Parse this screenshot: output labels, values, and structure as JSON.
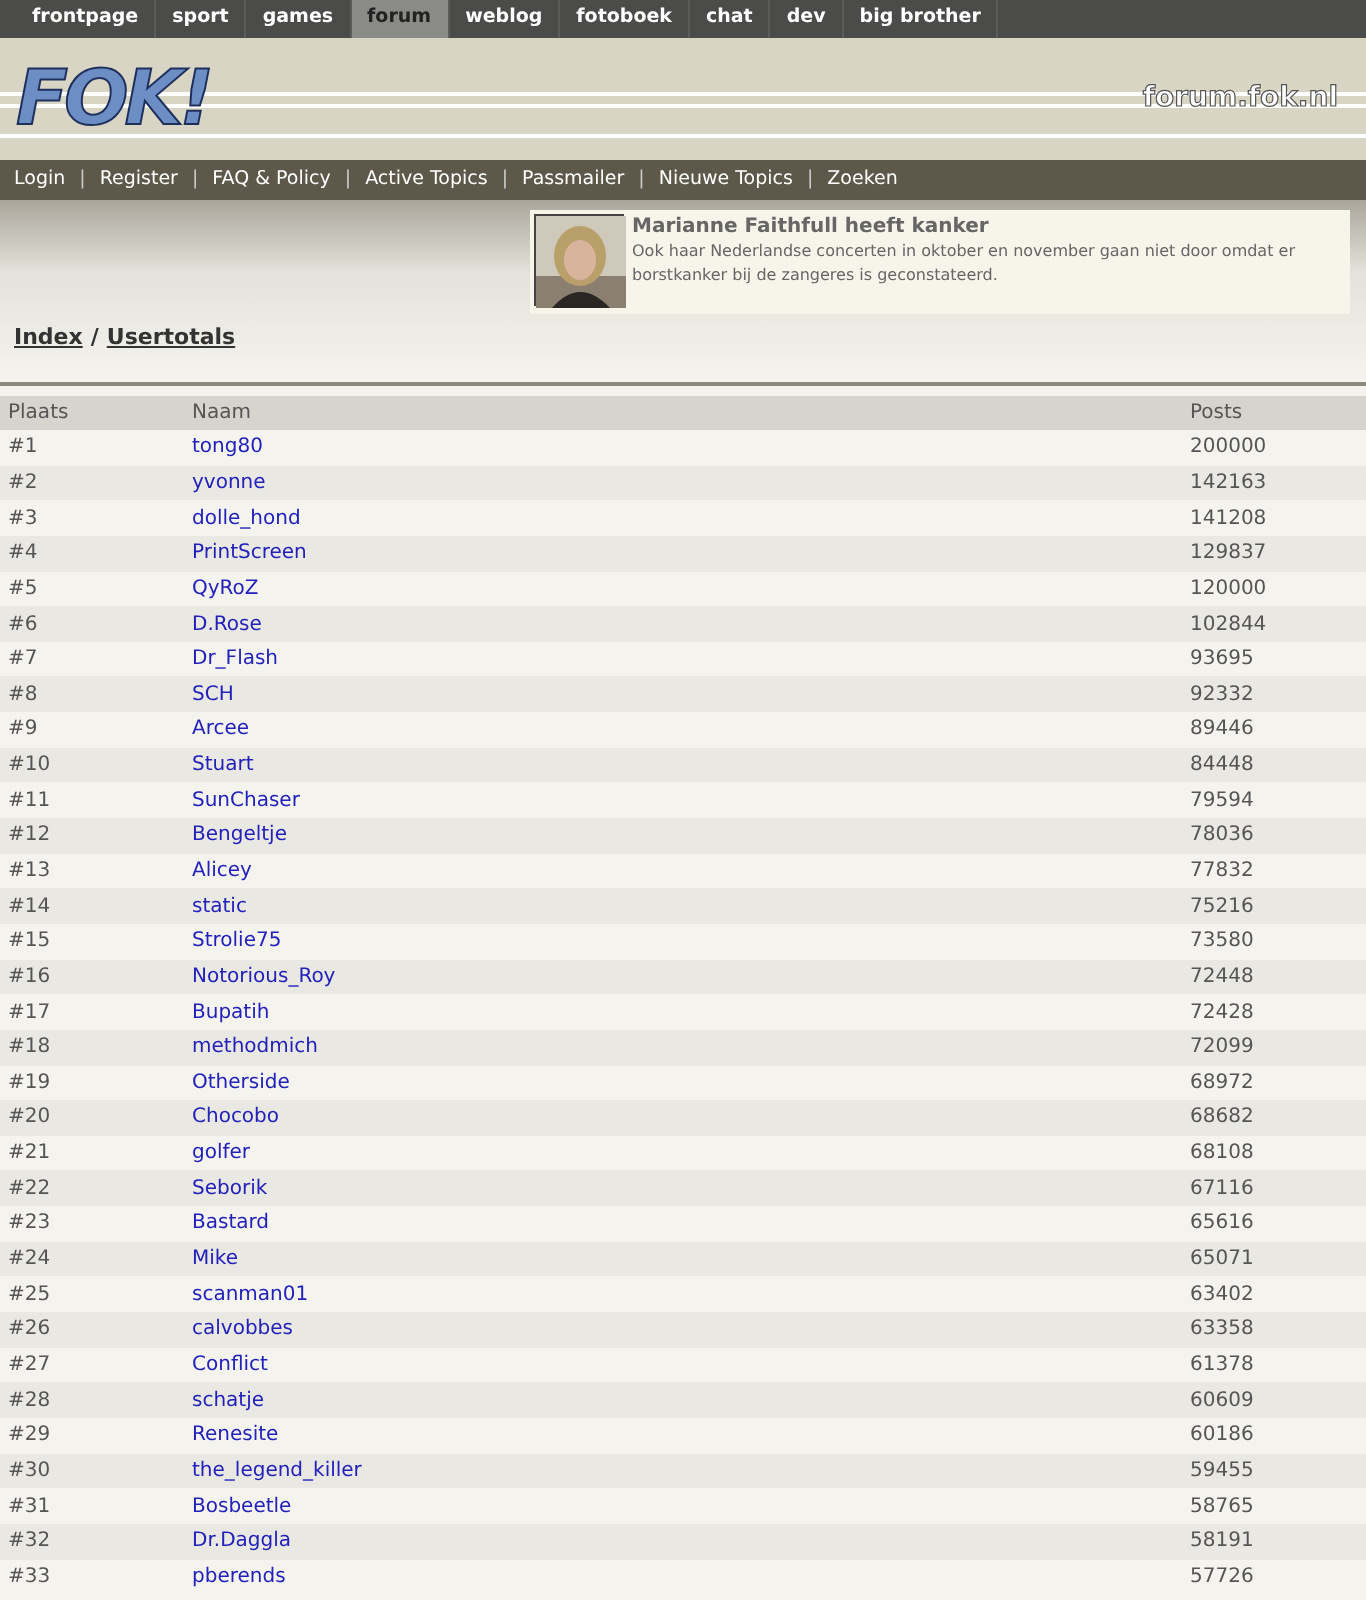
{
  "top_nav": [
    {
      "label": "frontpage",
      "selected": false
    },
    {
      "label": "sport",
      "selected": false
    },
    {
      "label": "games",
      "selected": false
    },
    {
      "label": "forum",
      "selected": true
    },
    {
      "label": "weblog",
      "selected": false
    },
    {
      "label": "fotoboek",
      "selected": false
    },
    {
      "label": "chat",
      "selected": false
    },
    {
      "label": "dev",
      "selected": false
    },
    {
      "label": "big brother",
      "selected": false
    }
  ],
  "header": {
    "logo": "FOK!",
    "site": "forum.fok.nl"
  },
  "sub_nav": [
    {
      "label": "Login"
    },
    {
      "separator": "|",
      "label": "Register"
    },
    {
      "separator": "|",
      "label": "FAQ & Policy"
    },
    {
      "separator": "|",
      "label": "Active Topics"
    },
    {
      "separator": "|",
      "label": "Passmailer"
    },
    {
      "separator": "|",
      "label": "Nieuwe Topics"
    },
    {
      "separator": "|",
      "label": "Zoeken"
    }
  ],
  "news": {
    "kind": "picture",
    "title": "Marianne Faithfull heeft kanker",
    "text": "Ook haar Nederlandse concerten in oktober en november gaan niet door omdat er borstkanker bij de zangeres is geconstateerd."
  },
  "breadcrumb": [
    {
      "label": "Index"
    },
    {
      "separator": "/",
      "label": "Usertotals"
    }
  ],
  "table": {
    "columns": [
      "Plaats",
      "Naam",
      "Posts"
    ],
    "rows": [
      [
        "#1",
        "tong80",
        "200000"
      ],
      [
        "#2",
        "yvonne",
        "142163"
      ],
      [
        "#3",
        "dolle_hond",
        "141208"
      ],
      [
        "#4",
        "PrintScreen",
        "129837"
      ],
      [
        "#5",
        "QyRoZ",
        "120000"
      ],
      [
        "#6",
        "D.Rose",
        "102844"
      ],
      [
        "#7",
        "Dr_Flash",
        "93695"
      ],
      [
        "#8",
        "SCH",
        "92332"
      ],
      [
        "#9",
        "Arcee",
        "89446"
      ],
      [
        "#10",
        "Stuart",
        "84448"
      ],
      [
        "#11",
        "SunChaser",
        "79594"
      ],
      [
        "#12",
        "Bengeltje",
        "78036"
      ],
      [
        "#13",
        "Alicey",
        "77832"
      ],
      [
        "#14",
        "static",
        "75216"
      ],
      [
        "#15",
        "Strolie75",
        "73580"
      ],
      [
        "#16",
        "Notorious_Roy",
        "72448"
      ],
      [
        "#17",
        "Bupatih",
        "72428"
      ],
      [
        "#18",
        "methodmich",
        "72099"
      ],
      [
        "#19",
        "Otherside",
        "68972"
      ],
      [
        "#20",
        "Chocobo",
        "68682"
      ],
      [
        "#21",
        "golfer",
        "68108"
      ],
      [
        "#22",
        "Seborik",
        "67116"
      ],
      [
        "#23",
        "Bastard",
        "65616"
      ],
      [
        "#24",
        "Mike",
        "65071"
      ],
      [
        "#25",
        "scanman01",
        "63402"
      ],
      [
        "#26",
        "calvobbes",
        "63358"
      ],
      [
        "#27",
        "Conflict",
        "61378"
      ],
      [
        "#28",
        "schatje",
        "60609"
      ],
      [
        "#29",
        "Renesite",
        "60186"
      ],
      [
        "#30",
        "the_legend_killer",
        "59455"
      ],
      [
        "#31",
        "Bosbeetle",
        "58765"
      ],
      [
        "#32",
        "Dr.Daggla",
        "58191"
      ],
      [
        "#33",
        "pberends",
        "57726"
      ]
    ]
  }
}
